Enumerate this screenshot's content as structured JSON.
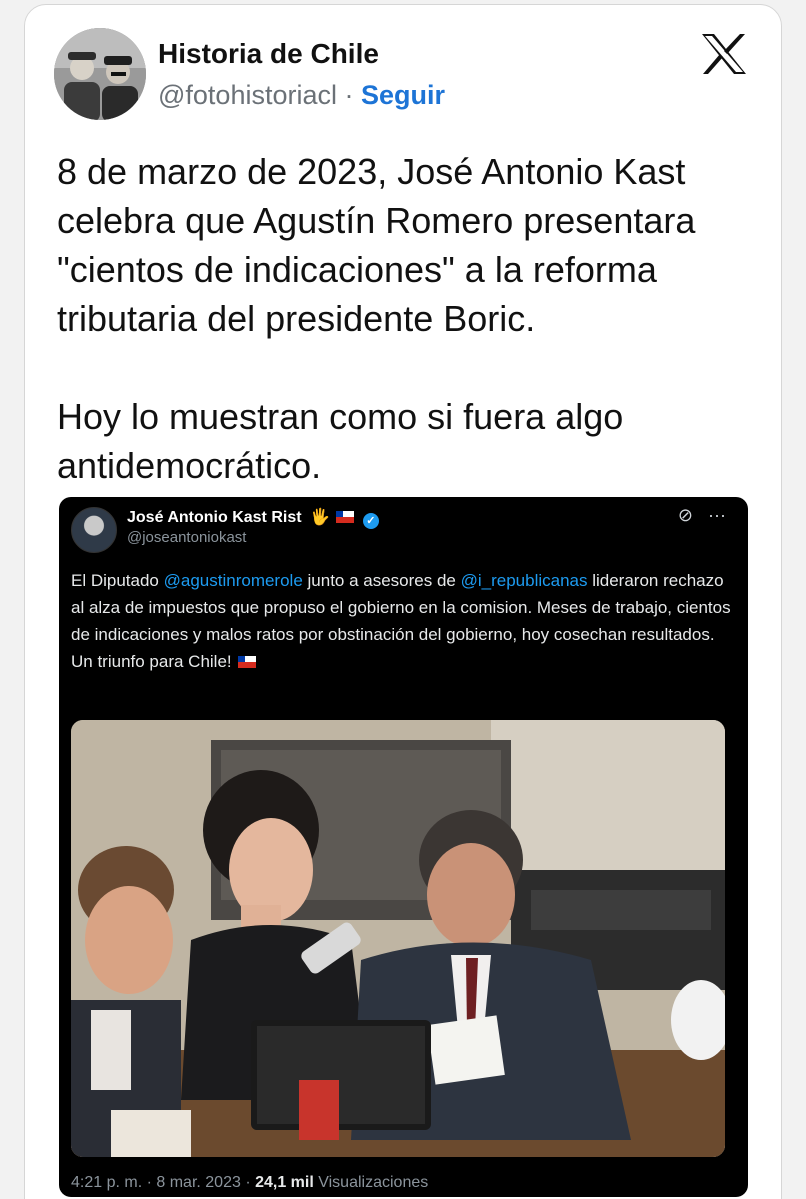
{
  "author": {
    "name": "Historia de Chile",
    "handle": "@fotohistoriacl",
    "separator": "·",
    "follow_label": "Seguir"
  },
  "tweet": {
    "text": "8 de marzo de 2023, José Antonio Kast celebra que Agustín Romero presentara \"cientos de indicaciones\" a la reforma tributaria del presidente Boric.\n\nHoy lo muestran como si fuera algo antidemocrático."
  },
  "embedded_tweet": {
    "name": "José Antonio Kast Rist",
    "name_emoji": "🖐",
    "handle": "@joseantoniokast",
    "text_parts": {
      "p1": "El Diputado ",
      "mention1": "@agustinromerole",
      "p2": " junto a asesores de ",
      "mention2": "@i_republicanas",
      "p3": " lideraron rechazo al alza de impuestos que propuso el gobierno en la comision. Meses de trabajo, cientos de indicaciones y malos ratos por obstinación del gobierno, hoy cosechan resultados. Un triunfo para Chile! "
    },
    "footer": {
      "time": "4:21 p. m. · 8 mar. 2023 · ",
      "views": "24,1 mil",
      "views_label": " Visualizaciones"
    }
  },
  "icons": {
    "x_logo": "x-logo-icon",
    "grok": "grok-icon",
    "more": "more-icon"
  },
  "colors": {
    "follow": "#1d74d6",
    "mention": "#1d9bf0",
    "embed_bg": "#000000"
  }
}
